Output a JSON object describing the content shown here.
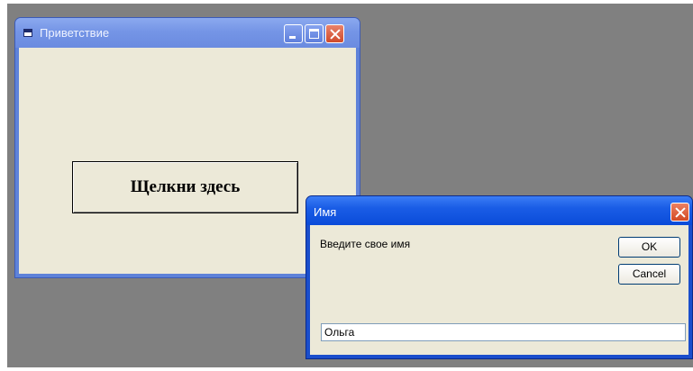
{
  "main_window": {
    "title": "Приветствие",
    "button_label": "Щелкни здесь",
    "controls": {
      "minimize": "minimize-icon",
      "maximize": "maximize-icon",
      "close": "close-icon"
    }
  },
  "input_dialog": {
    "title": "Имя",
    "prompt": "Введите свое имя",
    "ok_label": "OK",
    "cancel_label": "Cancel",
    "input_value": "Ольга",
    "controls": {
      "close": "close-icon"
    }
  },
  "colors": {
    "desktop": "#808080",
    "window_face": "#ece9d8",
    "active_title": "#0a4bd9",
    "inactive_title": "#7595e6",
    "close_button": "#d34a24"
  }
}
